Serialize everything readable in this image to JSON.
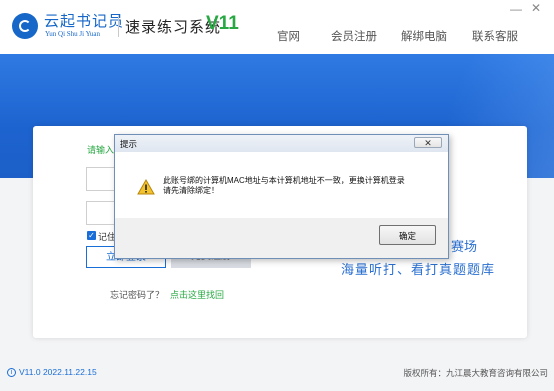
{
  "header": {
    "brand_cn": "云起书记员",
    "brand_en": "Yun Qi Shu Ji Yuan",
    "app_title": "速录练习系统",
    "app_version": "V11",
    "nav": [
      "官网",
      "会员注册",
      "解绑电脑",
      "联系客服"
    ],
    "minimize": "—",
    "close": "✕"
  },
  "login": {
    "hint": "请输入",
    "remember_label": "记住",
    "checkbox_mark": "✓",
    "login_button": "立即登录",
    "register_button": "免费注册",
    "forgot_text": "忘记密码了？",
    "forgot_link": "点击这里找回"
  },
  "promo": {
    "line1": "赛场",
    "line2": "海量听打、看打真题题库"
  },
  "dialog": {
    "title": "提示",
    "close": "✕",
    "message_line1": "此账号绑的计算机MAC地址与本计算机地址不一致，更换计算机登录",
    "message_line2": "请先清除绑定！",
    "ok_button": "确定",
    "icon": "warning-icon"
  },
  "footer": {
    "version": "V11.0 2022.11.22.15",
    "copyright": "版权所有：九江晨大教育咨询有限公司"
  }
}
